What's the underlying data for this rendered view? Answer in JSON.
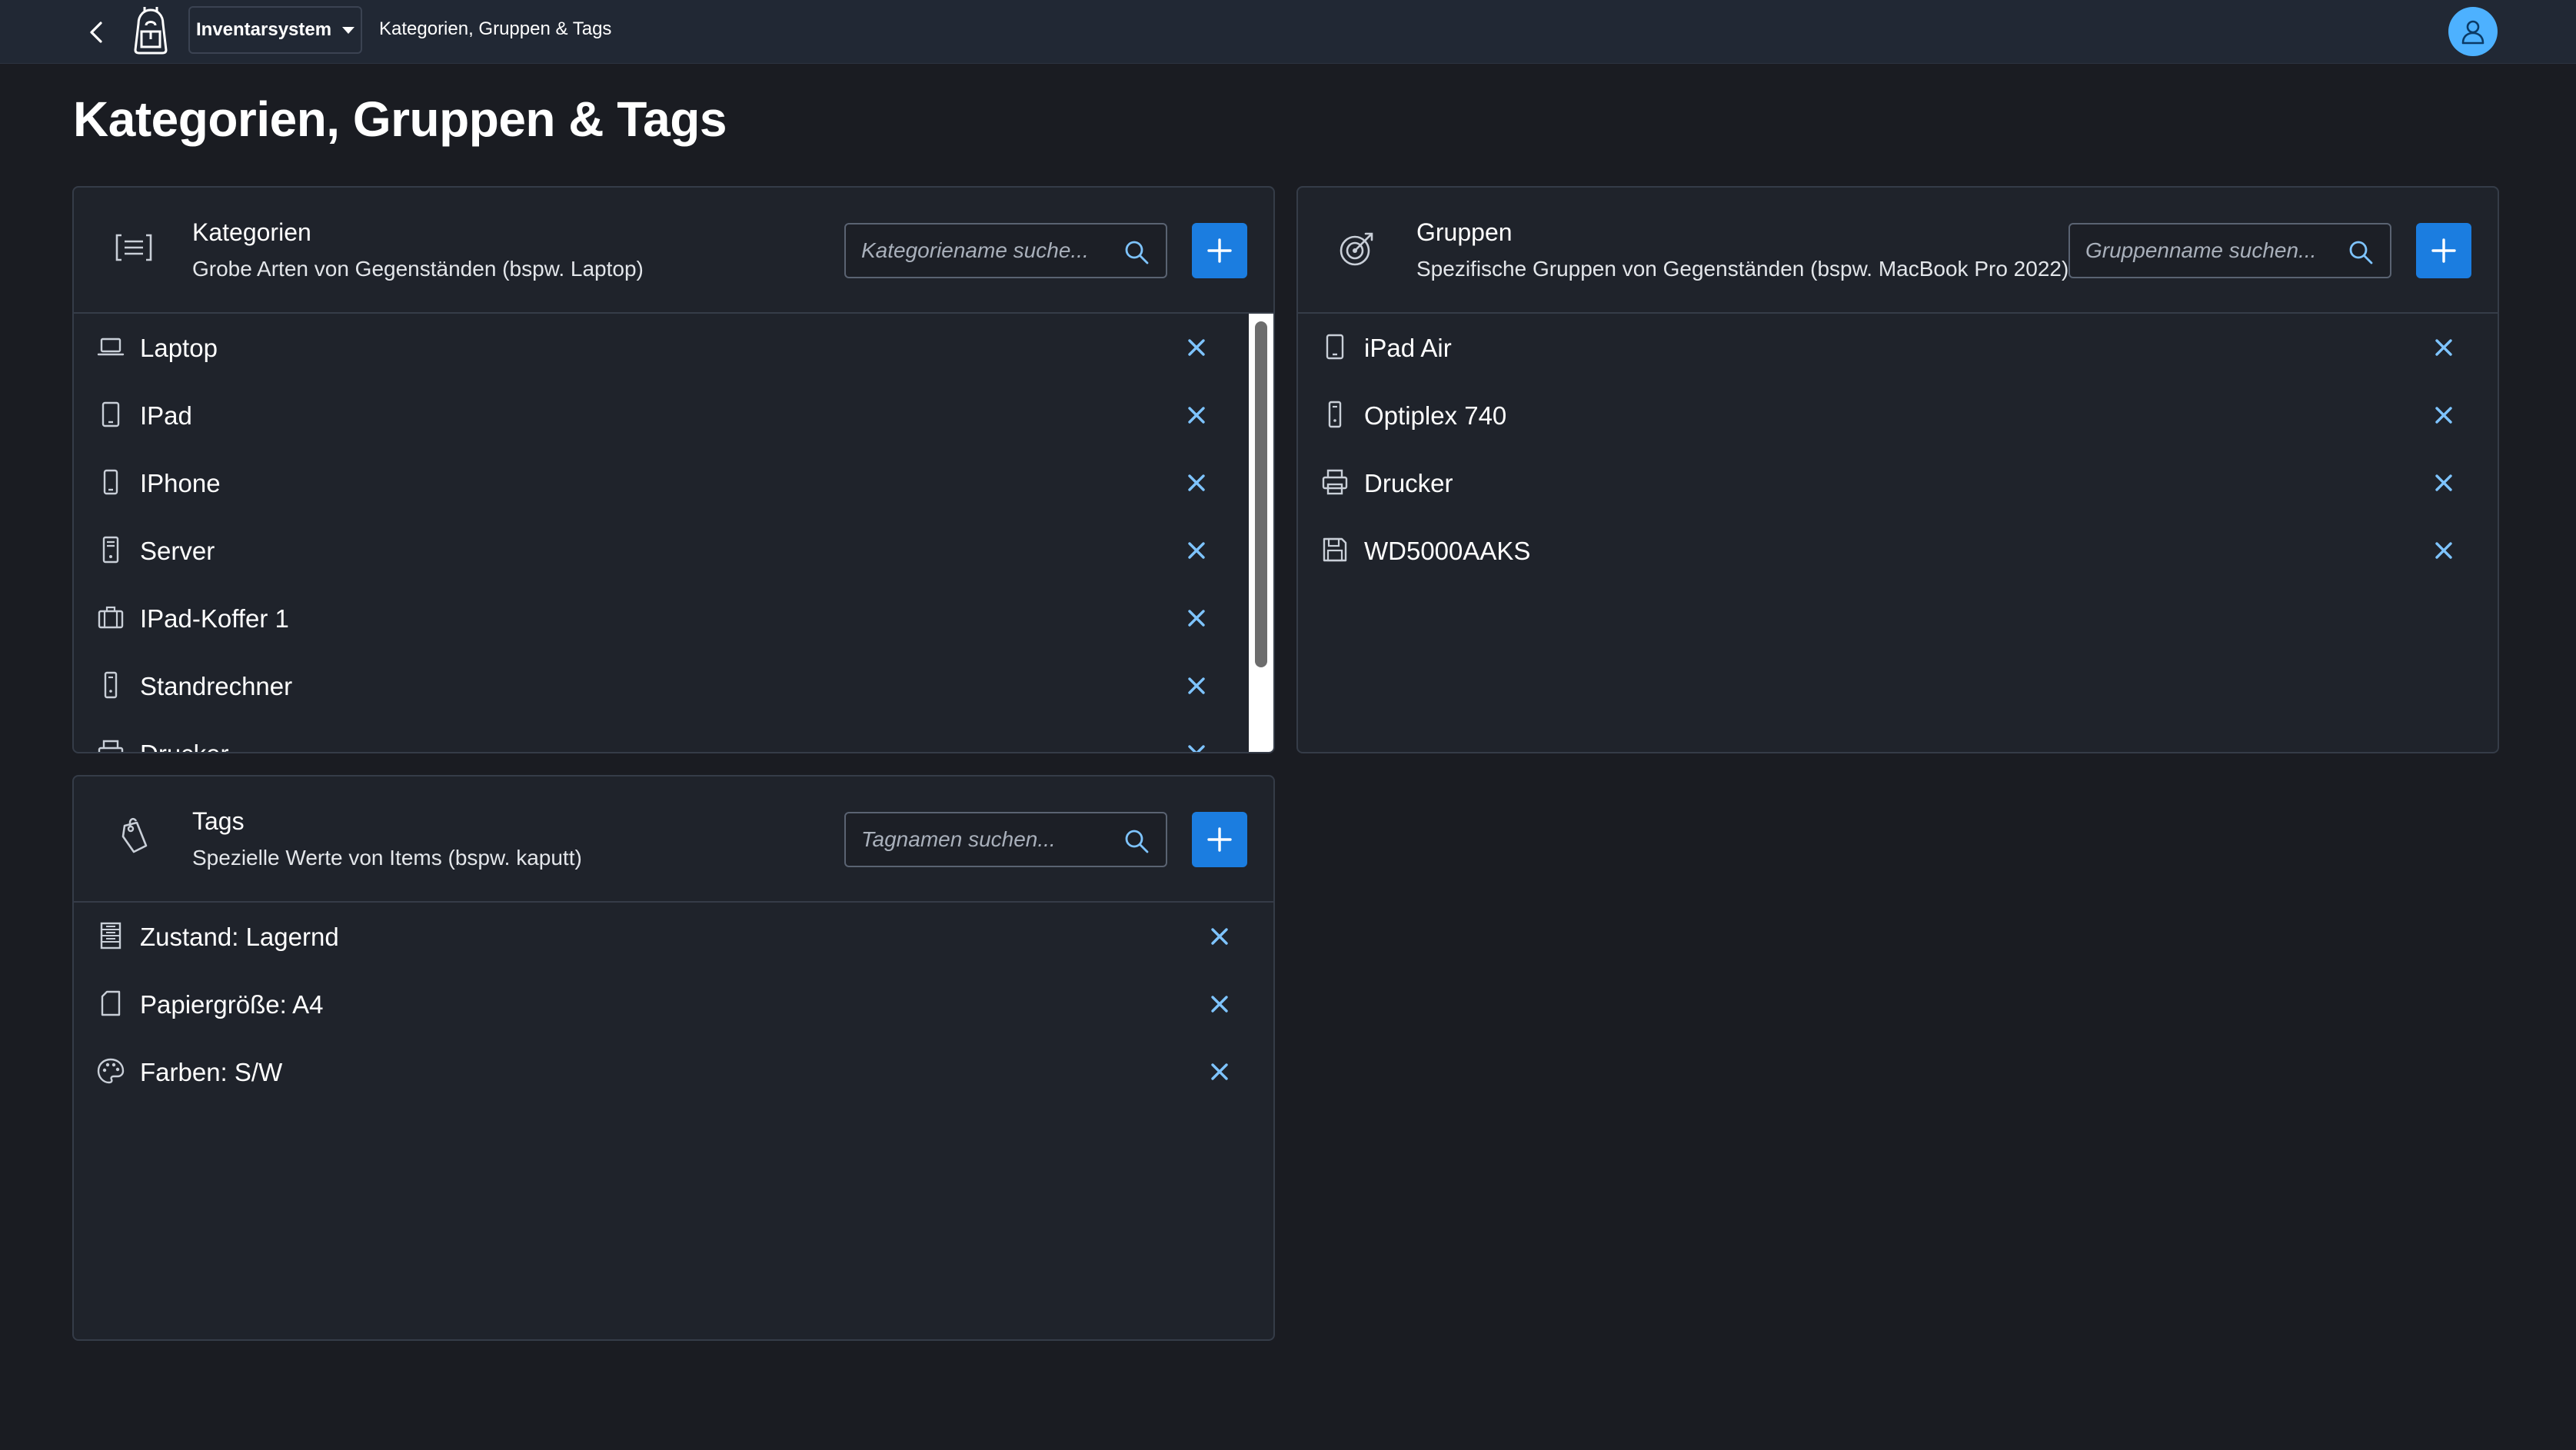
{
  "shell": {
    "app_name": "Inventarsystem",
    "breadcrumb": "Kategorien, Gruppen & Tags",
    "icons": {
      "back": "back-arrow-icon",
      "logo": "backpack-logo-icon",
      "caret": "caret-down-icon",
      "avatar": "user-icon"
    }
  },
  "page": {
    "title": "Kategorien, Gruppen & Tags"
  },
  "colors": {
    "accent": "#1b7de0",
    "delete_x": "#7ec4ff",
    "avatar": "#4db1ff",
    "background": "#1a1c22",
    "card": "#1f232b"
  },
  "kategorien": {
    "title": "Kategorien",
    "subtitle": "Grobe Arten von Gegenständen (bspw. Laptop)",
    "search_placeholder": "Kategoriename suche...",
    "header_icon": "list-icon",
    "items": [
      {
        "label": "Laptop",
        "icon": "laptop-icon"
      },
      {
        "label": "IPad",
        "icon": "tablet-icon"
      },
      {
        "label": "IPhone",
        "icon": "phone-icon"
      },
      {
        "label": "Server",
        "icon": "server-icon"
      },
      {
        "label": "IPad-Koffer 1",
        "icon": "briefcase-icon"
      },
      {
        "label": "Standrechner",
        "icon": "desktop-tower-icon"
      },
      {
        "label": "Drucker",
        "icon": "printer-icon"
      }
    ]
  },
  "gruppen": {
    "title": "Gruppen",
    "subtitle": "Spezifische Gruppen von Gegenständen (bspw. MacBook Pro 2022)",
    "search_placeholder": "Gruppenname suchen...",
    "header_icon": "target-icon",
    "items": [
      {
        "label": "iPad Air",
        "icon": "tablet-icon"
      },
      {
        "label": "Optiplex 740",
        "icon": "desktop-tower-icon"
      },
      {
        "label": "Drucker",
        "icon": "printer-icon"
      },
      {
        "label": "WD5000AAKS",
        "icon": "floppy-disk-icon"
      }
    ]
  },
  "tags": {
    "title": "Tags",
    "subtitle": "Spezielle Werte von Items (bspw. kaputt)",
    "search_placeholder": "Tagnamen suchen...",
    "header_icon": "tag-icon",
    "items": [
      {
        "label": "Zustand: Lagernd",
        "icon": "shelf-icon"
      },
      {
        "label": "Papiergröße: A4",
        "icon": "document-icon"
      },
      {
        "label": "Farben: S/W",
        "icon": "palette-icon"
      }
    ]
  }
}
